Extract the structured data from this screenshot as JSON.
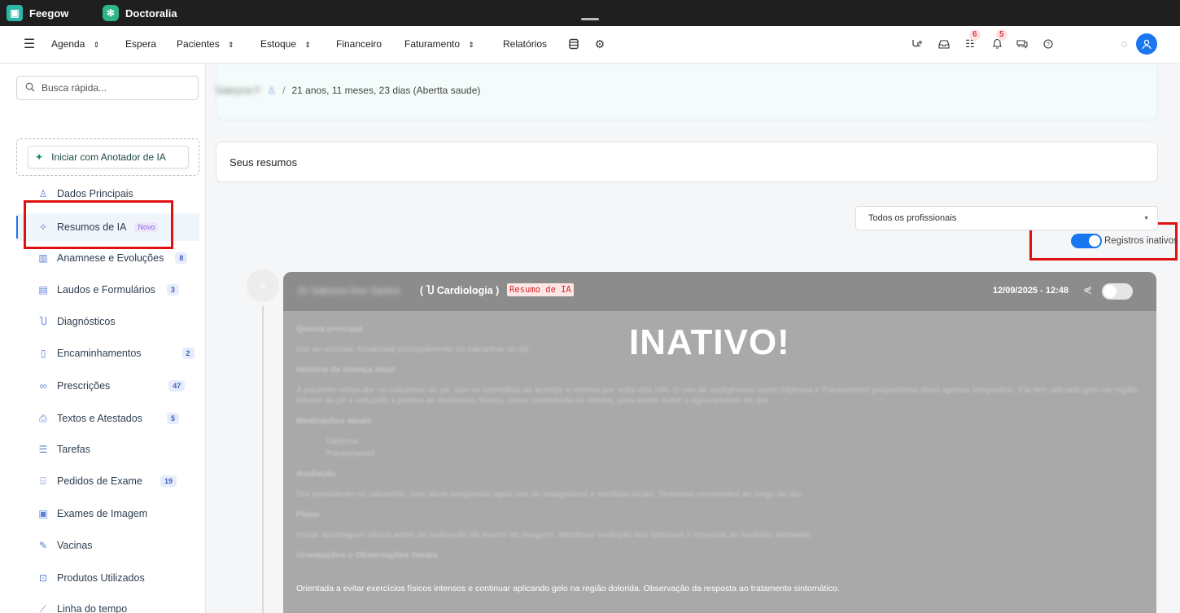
{
  "apps": [
    {
      "label": "Feegow",
      "icon": "feegow-logo-icon"
    },
    {
      "label": "Doctoralia",
      "icon": "doctoralia-logo-icon"
    }
  ],
  "nav": {
    "items": [
      "Agenda",
      "Espera",
      "Pacientes",
      "Estoque",
      "Financeiro",
      "Faturamento",
      "Relatórios"
    ],
    "chevron": "⌃",
    "badges": {
      "tasks": "6",
      "notifications": "5"
    }
  },
  "sidebar": {
    "search_placeholder": "Busca rápida...",
    "ai_button": "Iniciar com Anotador de IA",
    "items": [
      {
        "label": "Dados Principais",
        "icon": "user-icon",
        "count": ""
      },
      {
        "label": "Resumos de IA",
        "icon": "sparkle-icon",
        "count": "",
        "badge": "Novo"
      },
      {
        "label": "Anamnese e Evoluções",
        "icon": "chart-icon",
        "count": "8"
      },
      {
        "label": "Laudos e Formulários",
        "icon": "clipboard-icon",
        "count": "3"
      },
      {
        "label": "Diagnósticos",
        "icon": "stethoscope-icon",
        "count": ""
      },
      {
        "label": "Encaminhamentos",
        "icon": "file-icon",
        "count": "2"
      },
      {
        "label": "Prescrições",
        "icon": "pills-icon",
        "count": "47"
      },
      {
        "label": "Textos e Atestados",
        "icon": "document-icon",
        "count": "5"
      },
      {
        "label": "Tarefas",
        "icon": "list-icon",
        "count": ""
      },
      {
        "label": "Pedidos de Exame",
        "icon": "lab-icon",
        "count": "19"
      },
      {
        "label": "Exames de Imagem",
        "icon": "image-icon",
        "count": ""
      },
      {
        "label": "Vacinas",
        "icon": "syringe-icon",
        "count": ""
      },
      {
        "label": "Produtos Utilizados",
        "icon": "box-icon",
        "count": ""
      },
      {
        "label": "Linha do tempo",
        "icon": "timeline-icon",
        "count": ""
      }
    ]
  },
  "patient": {
    "name": "Sabryna F",
    "info": "21 anos, 11 meses, 23 dias (Abertta saude)"
  },
  "summaries": {
    "title": "Seus resumos",
    "filter": "Todos os profissionais",
    "toggle_label": "Registros inativos"
  },
  "record": {
    "professional": "Dr Sabryna Dos Santos",
    "specialty": "Cardiologia",
    "tag": "Resumo de IA",
    "datetime": "12/09/2025 - 12:48",
    "status": "INATIVO!",
    "sections": [
      {
        "heading": "Queixa principal",
        "text": "Dor ao acordar, localizada principalmente no calcanhar do pé."
      },
      {
        "heading": "História da doença atual",
        "text": "A paciente relata dor no calcanhar do pé, que se intensifica ao acordar e retorna por volta das 16h. O uso de analgésicos como Dipirona e Paracetamol proporciona alívio apenas temporário. Ela tem utilizado gelo na região inferior do pé e reduzido a prática de exercícios físicos, como caminhada na esteira, para tentar evitar o agravamento da dor."
      },
      {
        "heading": "Medicações atuais",
        "list": [
          "Dipirona",
          "Paracetamol"
        ]
      },
      {
        "heading": "Avaliação",
        "text": "Dor persistente no calcanhar, com alívio temporário após uso de analgésicos e medidas locais. Sintomas recorrentes ao longo do dia."
      },
      {
        "heading": "Plano",
        "text": "Iniciar abordagem clínica antes da realização de exame de imagens. Monitorar evolução dos sintomas e resposta às medidas adotadas."
      },
      {
        "heading": "Orientações e Observações Gerais",
        "text": ""
      }
    ],
    "last_line": "Orientada a evitar exercícios físicos intensos e continuar aplicando gelo na região dolorida. Observação da resposta ao tratamento sintomático."
  }
}
